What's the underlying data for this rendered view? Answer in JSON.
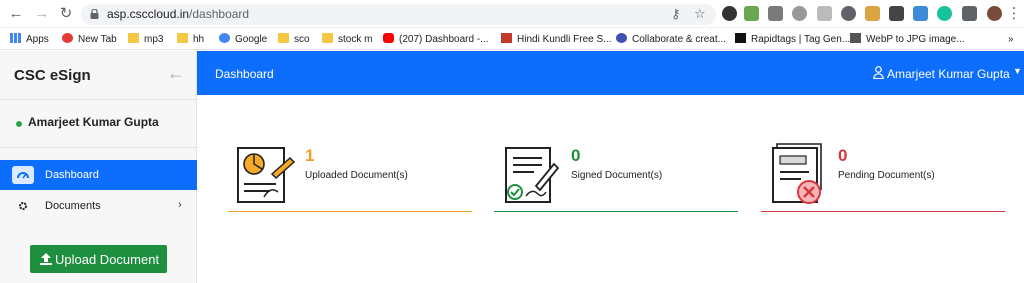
{
  "browser": {
    "url_host": "asp.csccloud.in",
    "url_path": "/dashboard",
    "bookmarks": [
      {
        "label": "Apps"
      },
      {
        "label": "New Tab"
      },
      {
        "label": "mp3"
      },
      {
        "label": "hh"
      },
      {
        "label": "Google"
      },
      {
        "label": "sco"
      },
      {
        "label": "stock m"
      },
      {
        "label": "(207) Dashboard -..."
      },
      {
        "label": "Hindi Kundli Free S..."
      },
      {
        "label": "Collaborate & creat..."
      },
      {
        "label": "Rapidtags | Tag Gen..."
      },
      {
        "label": "WebP to JPG image..."
      }
    ],
    "overflow": "»"
  },
  "sidebar": {
    "brand": "CSC eSign",
    "user_name": "Amarjeet Kumar Gupta",
    "menu": [
      {
        "label": "Dashboard",
        "active": true
      },
      {
        "label": "Documents",
        "active": false
      }
    ],
    "upload_label": "Upload Document"
  },
  "topbar": {
    "title": "Dashboard",
    "user_name": "Amarjeet Kumar Gupta"
  },
  "cards": [
    {
      "count": "1",
      "label": "Uploaded Document(s)",
      "color": "#f0a020",
      "icon": "uploaded-document-icon"
    },
    {
      "count": "0",
      "label": "Signed Document(s)",
      "color": "#1e8f3f",
      "icon": "signed-document-icon"
    },
    {
      "count": "0",
      "label": "Pending Document(s)",
      "color": "#d9363e",
      "icon": "pending-document-icon"
    }
  ]
}
